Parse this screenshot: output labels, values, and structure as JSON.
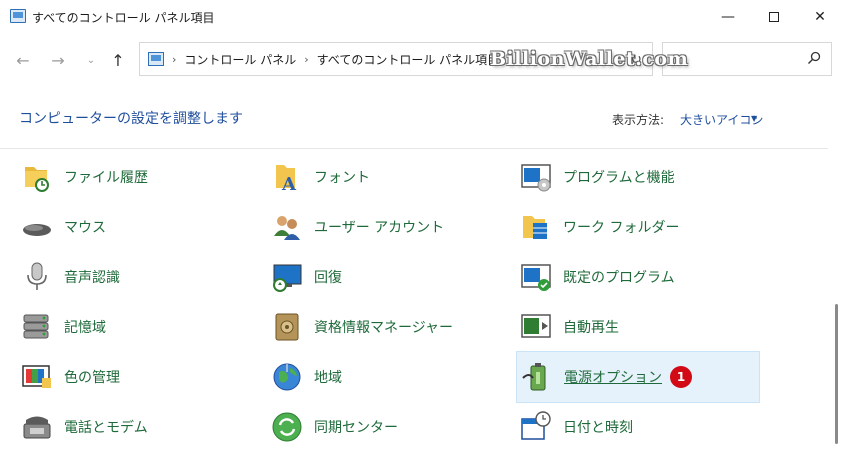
{
  "window": {
    "title": "すべてのコントロール パネル項目",
    "min_glyph": "—",
    "close_glyph": "✕"
  },
  "nav": {
    "back_glyph": "←",
    "forward_glyph": "→",
    "recent_glyph": "⌄",
    "up_glyph": "↑",
    "breadcrumbs": [
      "コントロール パネル",
      "すべてのコントロール パネル項目"
    ],
    "separator": "›",
    "refresh_glyph": "↻"
  },
  "watermark": "BillionWallet.com",
  "header": {
    "title": "コンピューターの設定を調整します",
    "view_label": "表示方法:",
    "view_value": "大きいアイコン",
    "view_caret": "▼"
  },
  "items": [
    {
      "label": "ファイル履歴",
      "icon": "file-history-icon"
    },
    {
      "label": "フォント",
      "icon": "fonts-icon"
    },
    {
      "label": "プログラムと機能",
      "icon": "programs-features-icon"
    },
    {
      "label": "マウス",
      "icon": "mouse-icon"
    },
    {
      "label": "ユーザー アカウント",
      "icon": "user-accounts-icon"
    },
    {
      "label": "ワーク フォルダー",
      "icon": "work-folders-icon"
    },
    {
      "label": "音声認識",
      "icon": "microphone-icon"
    },
    {
      "label": "回復",
      "icon": "recovery-icon"
    },
    {
      "label": "既定のプログラム",
      "icon": "default-programs-icon"
    },
    {
      "label": "記憶域",
      "icon": "storage-spaces-icon"
    },
    {
      "label": "資格情報マネージャー",
      "icon": "credential-manager-icon"
    },
    {
      "label": "自動再生",
      "icon": "autoplay-icon"
    },
    {
      "label": "色の管理",
      "icon": "color-management-icon"
    },
    {
      "label": "地域",
      "icon": "region-globe-icon"
    },
    {
      "label": "電源オプション",
      "icon": "power-options-icon",
      "badge": "1"
    },
    {
      "label": "電話とモデム",
      "icon": "phone-modem-icon"
    },
    {
      "label": "同期センター",
      "icon": "sync-center-icon"
    },
    {
      "label": "日付と時刻",
      "icon": "date-time-icon"
    }
  ],
  "colors": {
    "link_green": "#1f6a3a",
    "heading_blue": "#1f4e9c",
    "highlight_bg": "#e5f1fb",
    "badge_red": "#d10a16"
  }
}
